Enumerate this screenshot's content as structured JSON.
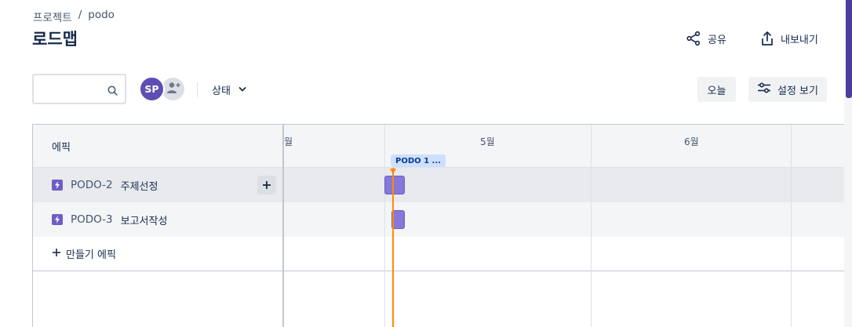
{
  "breadcrumb": {
    "root": "프로젝트",
    "sep": "/",
    "project": "podo"
  },
  "title": "로드맵",
  "header_actions": {
    "share": "공유",
    "export": "내보내기"
  },
  "toolbar": {
    "search_placeholder": "",
    "avatar_initials": "SP",
    "status_label": "상태",
    "today_label": "오늘",
    "view_settings_label": "설정 보기"
  },
  "left_panel": {
    "header": "에픽",
    "epics": [
      {
        "key": "PODO-2",
        "name": "주제선정"
      },
      {
        "key": "PODO-3",
        "name": "보고서작성"
      }
    ],
    "create_label": "만들기 에픽"
  },
  "timeline": {
    "months": [
      "월",
      "5월",
      "6월"
    ],
    "release_label": "PODO 1 ...",
    "today_color": "#ff8b00",
    "bar_color": "#8777d9"
  }
}
